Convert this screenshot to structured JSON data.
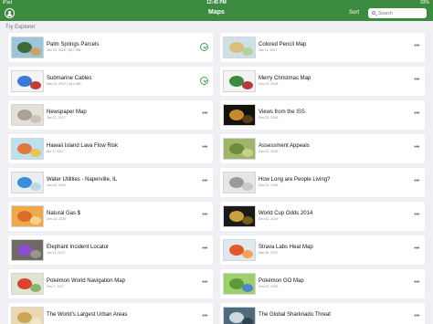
{
  "status_bar": {
    "carrier": "iPad",
    "time": "12:45 PM",
    "battery": "93%"
  },
  "navbar": {
    "title": "Maps",
    "sort_label": "Sort",
    "search_placeholder": "Search",
    "profile_icon": "person-circle-icon"
  },
  "section": {
    "label": "Try Explorer"
  },
  "maps": [
    {
      "name": "Palm Springs Parcels",
      "date": "Jan 25, 2016 | 58.7 MB",
      "action": "download",
      "thumb": {
        "bg": "#9cc5d9",
        "a": "#3d6a38",
        "b": "#c9a46a"
      }
    },
    {
      "name": "Colored Pencil Map",
      "date": "Jan 11, 2017",
      "action": "more",
      "thumb": {
        "bg": "#cfe0e8",
        "a": "#d8c07a",
        "b": "#b7d0a0"
      }
    },
    {
      "name": "Submarine Cables",
      "date": "Mar 23, 2017 | 36.4 MB",
      "action": "download",
      "thumb": {
        "bg": "#f4f4f4",
        "a": "#3a7bd5",
        "b": "#c43b3b"
      }
    },
    {
      "name": "Merry Christmas Map",
      "date": "Dec 23, 2016",
      "action": "more",
      "thumb": {
        "bg": "#f3f3f3",
        "a": "#3b8a3f",
        "b": "#b33a3a"
      }
    },
    {
      "name": "Newspaper Map",
      "date": "Jan 11, 2017",
      "action": "more",
      "thumb": {
        "bg": "#e4e0d8",
        "a": "#a9a397",
        "b": "#cbc5b8"
      }
    },
    {
      "name": "Views from the ISS",
      "date": "Dec 22, 2016",
      "action": "more",
      "thumb": {
        "bg": "#15110c",
        "a": "#c48a2d",
        "b": "#5a3d18"
      }
    },
    {
      "name": "Hawaii Island Lava Flow Risk",
      "date": "Apr 5, 2017",
      "action": "more",
      "thumb": {
        "bg": "#bfe0ef",
        "a": "#e07a3f",
        "b": "#e9c35a"
      }
    },
    {
      "name": "Assessment Appeals",
      "date": "Dec 22, 2016",
      "action": "more",
      "thumb": {
        "bg": "#9fb56a",
        "a": "#6f8a3a",
        "b": "#c7d08c"
      }
    },
    {
      "name": "Water Utilities - Naperville, IL",
      "date": "Jan 18, 2016",
      "action": "more",
      "thumb": {
        "bg": "#e8eef2",
        "a": "#3a8fd8",
        "b": "#bcd7ea"
      }
    },
    {
      "name": "How Long are People Living?",
      "date": "Dec 22, 2016",
      "action": "more",
      "thumb": {
        "bg": "#e6e6e6",
        "a": "#9a9a9a",
        "b": "#c8c8c8"
      }
    },
    {
      "name": "Natural Gas $",
      "date": "Dec 22, 2016",
      "action": "more",
      "thumb": {
        "bg": "#f0a84d",
        "a": "#d96d2a",
        "b": "#f6d28c"
      }
    },
    {
      "name": "World Cup Odds 2014",
      "date": "Dec 22, 2016",
      "action": "more",
      "thumb": {
        "bg": "#1a1a1a",
        "a": "#c8a23c",
        "b": "#7a5a1c"
      }
    },
    {
      "name": "Elephant Incident Locator",
      "date": "Jan 11, 2017",
      "action": "more",
      "thumb": {
        "bg": "#6f6a63",
        "a": "#8a4fd0",
        "b": "#9a948a"
      }
    },
    {
      "name": "Strava Labs Heat Map",
      "date": "Mar 30, 2017",
      "action": "more",
      "thumb": {
        "bg": "#dfe8ee",
        "a": "#e05a2a",
        "b": "#f0a35a"
      }
    },
    {
      "name": "Pokémon World Navigation Map",
      "date": "Nov 7, 2017",
      "action": "more",
      "thumb": {
        "bg": "#dce6d0",
        "a": "#d8442f",
        "b": "#8fb070"
      }
    },
    {
      "name": "Pokémon GO Map",
      "date": "Dec 22, 2016",
      "action": "more",
      "thumb": {
        "bg": "#9dcf6a",
        "a": "#5d9a3c",
        "b": "#4b88c7"
      }
    },
    {
      "name": "The World's Largest Urban Areas",
      "date": "",
      "action": "more",
      "thumb": {
        "bg": "#e9d8b0",
        "a": "#caa55a",
        "b": "#f2e6c8"
      }
    },
    {
      "name": "The Global Sharknado Threat",
      "date": "",
      "action": "more",
      "thumb": {
        "bg": "#4e6a7c",
        "a": "#cfd9de",
        "b": "#2f4350"
      }
    }
  ]
}
